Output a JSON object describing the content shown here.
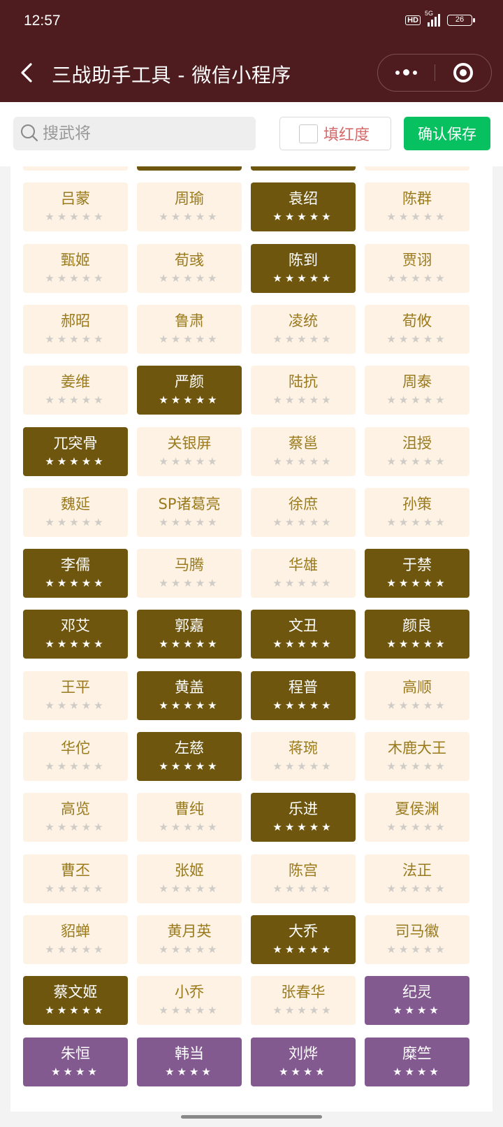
{
  "status_bar": {
    "time": "12:57",
    "hd": "HD",
    "network": "5G",
    "battery": "26"
  },
  "nav": {
    "title": "三战助手工具 - 微信小程序"
  },
  "toolbar": {
    "search_placeholder": "搜武将",
    "red_label": "填红度",
    "save_label": "确认保存"
  },
  "colors": {
    "nav_bg": "#4e1c1e",
    "tile_default": "#fdf2e4",
    "tile_selected": "#6f560f",
    "tile_purple": "#835a8f",
    "save_green": "#07c160"
  },
  "generals": [
    {
      "name": "",
      "state": "default",
      "stars": 5
    },
    {
      "name": "",
      "state": "gold",
      "stars": 5
    },
    {
      "name": "",
      "state": "gold",
      "stars": 5
    },
    {
      "name": "",
      "state": "default",
      "stars": 5
    },
    {
      "name": "吕蒙",
      "state": "default",
      "stars": 5
    },
    {
      "name": "周瑜",
      "state": "default",
      "stars": 5
    },
    {
      "name": "袁绍",
      "state": "gold",
      "stars": 5
    },
    {
      "name": "陈群",
      "state": "default",
      "stars": 5
    },
    {
      "name": "甄姬",
      "state": "default",
      "stars": 5
    },
    {
      "name": "荀彧",
      "state": "default",
      "stars": 5
    },
    {
      "name": "陈到",
      "state": "gold",
      "stars": 5
    },
    {
      "name": "贾诩",
      "state": "default",
      "stars": 5
    },
    {
      "name": "郝昭",
      "state": "default",
      "stars": 5
    },
    {
      "name": "鲁肃",
      "state": "default",
      "stars": 5
    },
    {
      "name": "凌统",
      "state": "default",
      "stars": 5
    },
    {
      "name": "荀攸",
      "state": "default",
      "stars": 5
    },
    {
      "name": "姜维",
      "state": "default",
      "stars": 5
    },
    {
      "name": "严颜",
      "state": "gold",
      "stars": 5
    },
    {
      "name": "陆抗",
      "state": "default",
      "stars": 5
    },
    {
      "name": "周泰",
      "state": "default",
      "stars": 5
    },
    {
      "name": "兀突骨",
      "state": "gold",
      "stars": 5
    },
    {
      "name": "关银屏",
      "state": "default",
      "stars": 5
    },
    {
      "name": "蔡邕",
      "state": "default",
      "stars": 5
    },
    {
      "name": "沮授",
      "state": "default",
      "stars": 5
    },
    {
      "name": "魏延",
      "state": "default",
      "stars": 5
    },
    {
      "name": "SP诸葛亮",
      "state": "default",
      "stars": 5
    },
    {
      "name": "徐庶",
      "state": "default",
      "stars": 5
    },
    {
      "name": "孙策",
      "state": "default",
      "stars": 5
    },
    {
      "name": "李儒",
      "state": "gold",
      "stars": 5
    },
    {
      "name": "马腾",
      "state": "default",
      "stars": 5
    },
    {
      "name": "华雄",
      "state": "default",
      "stars": 5
    },
    {
      "name": "于禁",
      "state": "gold",
      "stars": 5
    },
    {
      "name": "邓艾",
      "state": "gold",
      "stars": 5
    },
    {
      "name": "郭嘉",
      "state": "gold",
      "stars": 5
    },
    {
      "name": "文丑",
      "state": "gold",
      "stars": 5
    },
    {
      "name": "颜良",
      "state": "gold",
      "stars": 5
    },
    {
      "name": "王平",
      "state": "default",
      "stars": 5
    },
    {
      "name": "黄盖",
      "state": "gold",
      "stars": 5
    },
    {
      "name": "程普",
      "state": "gold",
      "stars": 5
    },
    {
      "name": "高顺",
      "state": "default",
      "stars": 5
    },
    {
      "name": "华佗",
      "state": "default",
      "stars": 5
    },
    {
      "name": "左慈",
      "state": "gold",
      "stars": 5
    },
    {
      "name": "蒋琬",
      "state": "default",
      "stars": 5
    },
    {
      "name": "木鹿大王",
      "state": "default",
      "stars": 5
    },
    {
      "name": "高览",
      "state": "default",
      "stars": 5
    },
    {
      "name": "曹纯",
      "state": "default",
      "stars": 5
    },
    {
      "name": "乐进",
      "state": "gold",
      "stars": 5
    },
    {
      "name": "夏侯渊",
      "state": "default",
      "stars": 5
    },
    {
      "name": "曹丕",
      "state": "default",
      "stars": 5
    },
    {
      "name": "张姬",
      "state": "default",
      "stars": 5
    },
    {
      "name": "陈宫",
      "state": "default",
      "stars": 5
    },
    {
      "name": "法正",
      "state": "default",
      "stars": 5
    },
    {
      "name": "貂蝉",
      "state": "default",
      "stars": 5
    },
    {
      "name": "黄月英",
      "state": "default",
      "stars": 5
    },
    {
      "name": "大乔",
      "state": "gold",
      "stars": 5
    },
    {
      "name": "司马徽",
      "state": "default",
      "stars": 5
    },
    {
      "name": "蔡文姬",
      "state": "gold",
      "stars": 5
    },
    {
      "name": "小乔",
      "state": "default",
      "stars": 5
    },
    {
      "name": "张春华",
      "state": "default",
      "stars": 5
    },
    {
      "name": "纪灵",
      "state": "purple",
      "stars": 4
    },
    {
      "name": "朱恒",
      "state": "purple",
      "stars": 4
    },
    {
      "name": "韩当",
      "state": "purple",
      "stars": 4
    },
    {
      "name": "刘烨",
      "state": "purple",
      "stars": 4
    },
    {
      "name": "糜竺",
      "state": "purple",
      "stars": 4
    }
  ]
}
